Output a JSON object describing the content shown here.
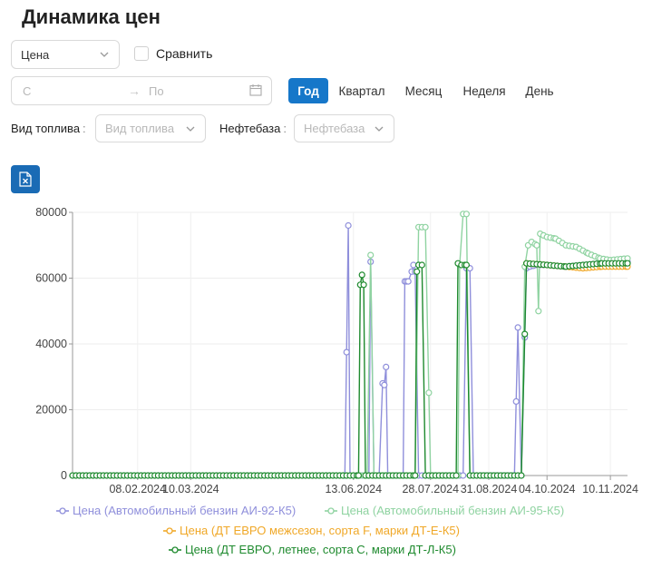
{
  "page": {
    "title": "Динамика цен"
  },
  "controls": {
    "metric_select": {
      "value": "Цена"
    },
    "compare_label": "Сравнить",
    "range": {
      "from_placeholder": "С",
      "arrow": "→",
      "to_placeholder": "По"
    },
    "periods": [
      "Год",
      "Квартал",
      "Месяц",
      "Неделя",
      "День"
    ],
    "active_period": "Год",
    "fuel_type_label": "Вид топлива",
    "fuel_type_placeholder": "Вид топлива",
    "depot_label": "Нефтебаза",
    "depot_placeholder": "Нефтебаза",
    "colon": ":"
  },
  "icons": {
    "excel": "excel-export-icon",
    "calendar": "calendar-icon",
    "chevron": "chevron-down-icon"
  },
  "colors": {
    "accent": "#1677c9",
    "ai92": "#8f8fdb",
    "ai95": "#8fd3a1",
    "dt_e": "#f0a828",
    "dt_l": "#1e8a2e"
  },
  "chart_data": {
    "type": "line",
    "ylim": [
      0,
      80000
    ],
    "yticks": [
      0,
      20000,
      40000,
      60000,
      80000
    ],
    "ytick_labels": [
      "0",
      "20000",
      "40000",
      "60000",
      "80000"
    ],
    "xlim": [
      "2024-01-01",
      "2024-11-20"
    ],
    "xticks": [
      "2024-02-08",
      "2024-03-10",
      "2024-06-13",
      "2024-07-28",
      "2024-08-31",
      "2024-10-04",
      "2024-11-10"
    ],
    "xtick_labels": [
      "08.02.2024",
      "10.03.2024",
      "13.06.2024",
      "28.07.2024",
      "31.08.2024",
      "04.10.2024",
      "10.11.2024"
    ],
    "grid": true,
    "legend_position": "bottom",
    "series": [
      {
        "name": "Цена (Автомобильный бензин АИ-92-К5)",
        "color": "#8f8fdb",
        "points": [
          [
            "2024-01-01",
            0
          ],
          [
            "2024-06-08",
            0
          ],
          [
            "2024-06-09",
            37500
          ],
          [
            "2024-06-10",
            76000
          ],
          [
            "2024-06-11",
            0
          ],
          [
            "2024-06-13",
            0
          ],
          [
            "2024-06-16",
            0
          ],
          [
            "2024-06-22",
            0
          ],
          [
            "2024-06-23",
            65000
          ],
          [
            "2024-06-25",
            0
          ],
          [
            "2024-06-28",
            0
          ],
          [
            "2024-06-30",
            28000
          ],
          [
            "2024-07-01",
            27500
          ],
          [
            "2024-07-02",
            33000
          ],
          [
            "2024-07-03",
            0
          ],
          [
            "2024-07-12",
            0
          ],
          [
            "2024-07-13",
            59000
          ],
          [
            "2024-07-14",
            59000
          ],
          [
            "2024-07-15",
            59000
          ],
          [
            "2024-07-17",
            62000
          ],
          [
            "2024-07-18",
            64000
          ],
          [
            "2024-07-19",
            62000
          ],
          [
            "2024-07-21",
            0
          ],
          [
            "2024-08-14",
            0
          ],
          [
            "2024-08-16",
            0
          ],
          [
            "2024-08-18",
            63000
          ],
          [
            "2024-08-20",
            63000
          ],
          [
            "2024-08-22",
            0
          ],
          [
            "2024-08-27",
            0
          ],
          [
            "2024-09-15",
            0
          ],
          [
            "2024-09-16",
            22500
          ],
          [
            "2024-09-17",
            45000
          ],
          [
            "2024-09-19",
            0
          ],
          [
            "2024-09-22",
            63000
          ],
          [
            "2024-09-24",
            63500
          ],
          [
            "2024-09-28",
            64000
          ],
          [
            "2024-10-04",
            64000
          ],
          [
            "2024-10-15",
            63500
          ],
          [
            "2024-10-25",
            64000
          ],
          [
            "2024-11-05",
            64500
          ],
          [
            "2024-11-20",
            65000
          ]
        ]
      },
      {
        "name": "Цена (Автомобильный бензин АИ-95-К5)",
        "color": "#8fd3a1",
        "points": [
          [
            "2024-01-01",
            0
          ],
          [
            "2024-06-21",
            0
          ],
          [
            "2024-06-23",
            67000
          ],
          [
            "2024-06-25",
            0
          ],
          [
            "2024-07-19",
            0
          ],
          [
            "2024-07-21",
            75500
          ],
          [
            "2024-07-23",
            75500
          ],
          [
            "2024-07-25",
            75500
          ],
          [
            "2024-07-28",
            0
          ],
          [
            "2024-08-13",
            0
          ],
          [
            "2024-08-14",
            64000
          ],
          [
            "2024-08-16",
            79500
          ],
          [
            "2024-08-18",
            79500
          ],
          [
            "2024-08-20",
            0
          ],
          [
            "2024-09-19",
            0
          ],
          [
            "2024-09-21",
            63500
          ],
          [
            "2024-09-23",
            70000
          ],
          [
            "2024-09-25",
            71000
          ],
          [
            "2024-09-28",
            70000
          ],
          [
            "2024-09-29",
            50000
          ],
          [
            "2024-09-30",
            73500
          ],
          [
            "2024-10-04",
            72500
          ],
          [
            "2024-10-09",
            72000
          ],
          [
            "2024-10-15",
            70000
          ],
          [
            "2024-10-21",
            69500
          ],
          [
            "2024-10-28",
            67500
          ],
          [
            "2024-11-04",
            66000
          ],
          [
            "2024-11-10",
            65500
          ],
          [
            "2024-11-20",
            66000
          ]
        ]
      },
      {
        "name": "Цена (ДТ ЕВРО межсезон, сорта F, марки ДТ-Е-К5)",
        "color": "#f0a828",
        "points": [
          [
            "2024-09-22",
            64500
          ],
          [
            "2024-10-04",
            64000
          ],
          [
            "2024-10-15",
            63500
          ],
          [
            "2024-10-25",
            63000
          ],
          [
            "2024-11-05",
            63500
          ],
          [
            "2024-11-20",
            63500
          ]
        ]
      },
      {
        "name": "Цена (ДТ ЕВРО, летнее, сорта С, марки ДТ-Л-К5)",
        "color": "#1e8a2e",
        "points": [
          [
            "2024-01-01",
            0
          ],
          [
            "2024-06-16",
            0
          ],
          [
            "2024-06-17",
            58000
          ],
          [
            "2024-06-18",
            61000
          ],
          [
            "2024-06-19",
            58000
          ],
          [
            "2024-06-20",
            0
          ],
          [
            "2024-07-19",
            0
          ],
          [
            "2024-07-20",
            62000
          ],
          [
            "2024-07-21",
            64000
          ],
          [
            "2024-07-23",
            64000
          ],
          [
            "2024-07-25",
            0
          ],
          [
            "2024-08-12",
            0
          ],
          [
            "2024-08-13",
            64500
          ],
          [
            "2024-08-15",
            64000
          ],
          [
            "2024-08-18",
            64000
          ],
          [
            "2024-08-20",
            0
          ],
          [
            "2024-09-19",
            0
          ],
          [
            "2024-09-22",
            64500
          ],
          [
            "2024-10-04",
            64000
          ],
          [
            "2024-10-15",
            63500
          ],
          [
            "2024-10-25",
            64000
          ],
          [
            "2024-11-05",
            64500
          ],
          [
            "2024-11-20",
            64500
          ]
        ]
      }
    ]
  }
}
